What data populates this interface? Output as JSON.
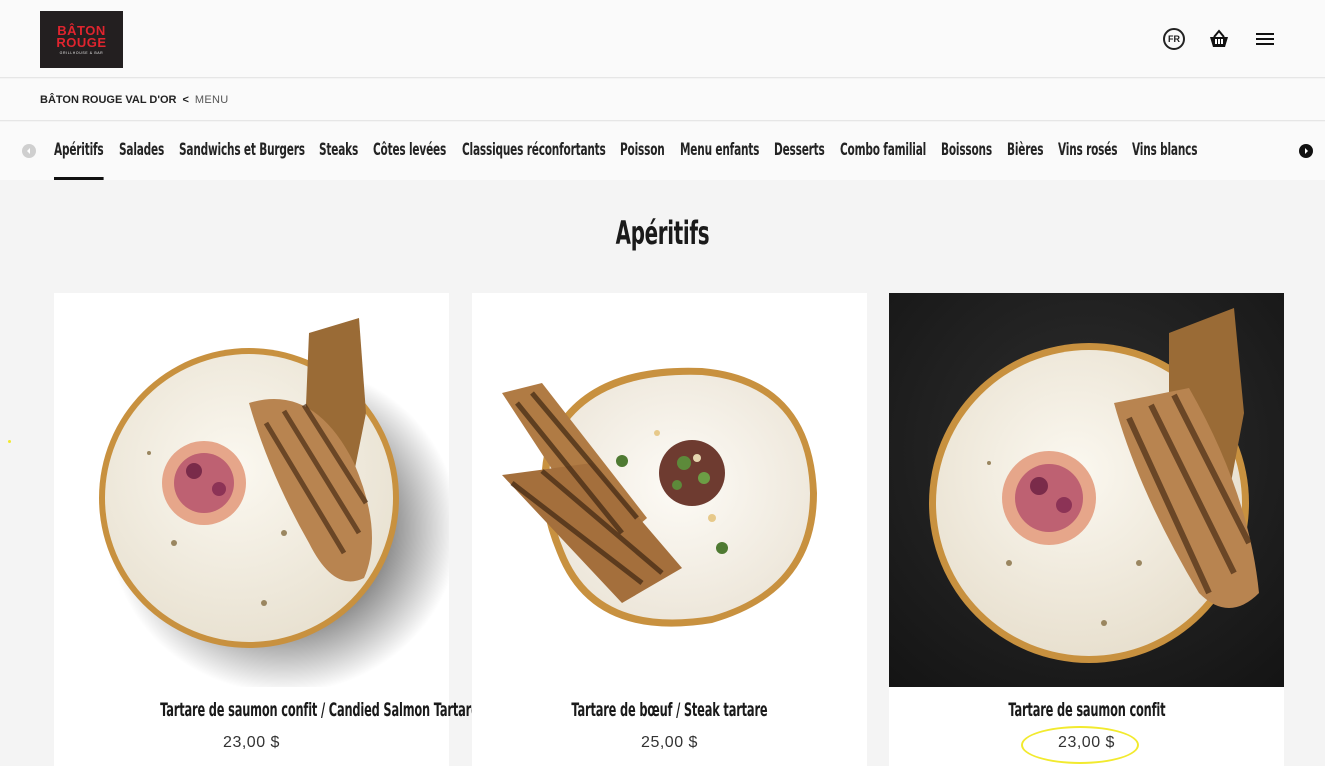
{
  "brand": {
    "line1": "BÂTON",
    "line2": "ROUGE",
    "tagline": "GRILLHOUSE & BAR"
  },
  "header": {
    "lang_label": "FR",
    "cart_icon": "basket-icon",
    "menu_icon": "hamburger-icon"
  },
  "breadcrumb": {
    "home": "BÂTON ROUGE VAL D'OR",
    "separator": "<",
    "current": "MENU"
  },
  "categories": [
    {
      "label": "Apéritifs",
      "active": true
    },
    {
      "label": "Salades"
    },
    {
      "label": "Sandwichs et Burgers"
    },
    {
      "label": "Steaks"
    },
    {
      "label": "Côtes levées"
    },
    {
      "label": "Classiques réconfortants"
    },
    {
      "label": "Poisson"
    },
    {
      "label": "Menu enfants"
    },
    {
      "label": "Desserts"
    },
    {
      "label": "Combo familial"
    },
    {
      "label": "Boissons"
    },
    {
      "label": "Bières"
    },
    {
      "label": "Vins rosés"
    },
    {
      "label": "Vins blancs"
    }
  ],
  "section": {
    "title": "Apéritifs"
  },
  "items": [
    {
      "name": "Tartare de saumon confit / Candied Salmon Tartare",
      "price": "23,00 $"
    },
    {
      "name": "Tartare de bœuf / Steak tartare",
      "price": "25,00 $"
    },
    {
      "name": "Tartare de saumon confit",
      "price": "23,00 $"
    }
  ],
  "colors": {
    "brand_red": "#e0242e",
    "logo_bg": "#231f20",
    "highlight": "#f2ea2e"
  }
}
